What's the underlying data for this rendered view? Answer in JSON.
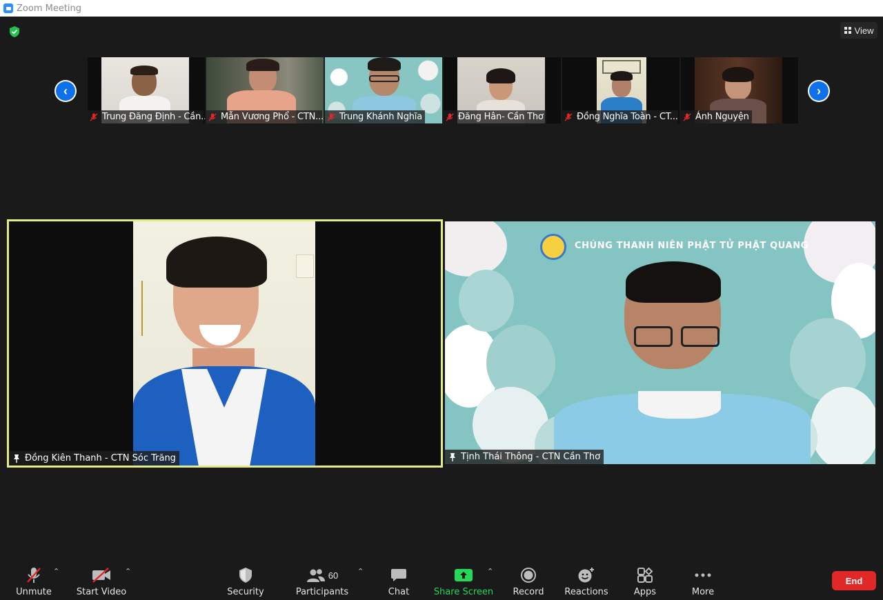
{
  "window": {
    "title": "Zoom Meeting"
  },
  "header": {
    "view_label": "View",
    "security_icon": "shield-check-icon",
    "accent_green": "#23c04c"
  },
  "gallery": {
    "prev_icon": "chevron-left-icon",
    "next_icon": "chevron-right-icon",
    "participants": [
      {
        "name": "Trung Đăng Định - Cần...",
        "muted": true
      },
      {
        "name": "Mẫn Vương Phổ - CTN...",
        "muted": true
      },
      {
        "name": "Trung Khánh Nghĩa",
        "muted": true
      },
      {
        "name": "Đăng Hân- Cần Thơ",
        "muted": true
      },
      {
        "name": "Đồng Nghĩa Toàn - CT...",
        "muted": true
      },
      {
        "name": "Ánh Nguyện",
        "muted": true
      }
    ]
  },
  "main": {
    "left": {
      "name": "Đồng Kiên Thanh - CTN Sóc Trăng",
      "pinned": true,
      "active_speaker": true
    },
    "right": {
      "name": "Tịnh Thái Thông - CTN Cần Thơ",
      "pinned": true,
      "banner": "CHÚNG THANH NIÊN PHẬT TỬ PHẬT QUANG"
    }
  },
  "toolbar": {
    "unmute": "Unmute",
    "start_video": "Start Video",
    "security": "Security",
    "participants": "Participants",
    "participant_count": "60",
    "chat": "Chat",
    "share_screen": "Share Screen",
    "record": "Record",
    "reactions": "Reactions",
    "apps": "Apps",
    "more": "More",
    "end": "End"
  },
  "colors": {
    "end": "#e02828",
    "share": "#23d959",
    "speaker_border": "#e4ec8a",
    "muted_red": "#e02828",
    "nav_blue": "#0e71eb"
  }
}
